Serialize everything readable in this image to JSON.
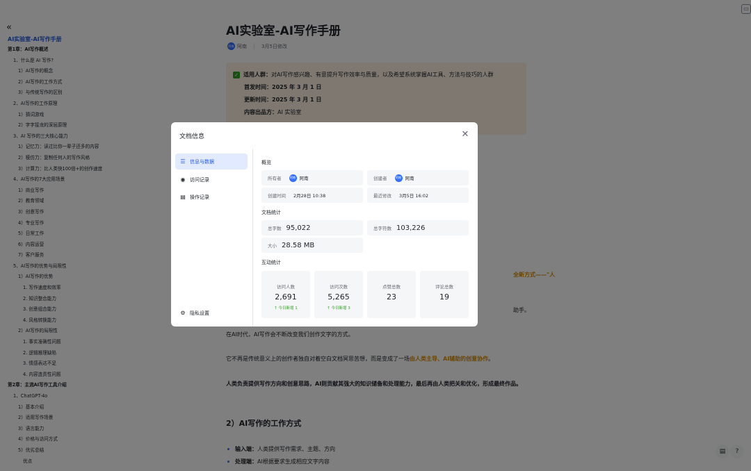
{
  "sidebar": {
    "collapse_icon": "«",
    "title": "AI实验室-AI写作手册",
    "items": [
      {
        "label": "第1章：AI写作概述",
        "level": 0
      },
      {
        "label": "1、什么是 AI 写作?",
        "level": 1
      },
      {
        "label": "1）AI写作的概念",
        "level": 2
      },
      {
        "label": "2）AI写作的工作方式",
        "level": 2
      },
      {
        "label": "3）与传统写作的区别",
        "level": 2
      },
      {
        "label": "2、AI写作的工作原理",
        "level": 1
      },
      {
        "label": "1）猜词游戏",
        "level": 2
      },
      {
        "label": "2）字字接龙的深层原理",
        "level": 2
      },
      {
        "label": "3、AI 写作的三大核心能力",
        "level": 1
      },
      {
        "label": "1）记忆力：读过比你一辈子还多的内容",
        "level": 2
      },
      {
        "label": "2）模仿力：复制任何人的写作风格",
        "level": 2
      },
      {
        "label": "3）计算力：比人类快100倍+的创作速度",
        "level": 2
      },
      {
        "label": "4、AI写作的7大应用场景",
        "level": 1
      },
      {
        "label": "1）商业写作",
        "level": 2
      },
      {
        "label": "2）教育领域",
        "level": 2
      },
      {
        "label": "3）创意写作",
        "level": 2
      },
      {
        "label": "4）专业写作",
        "level": 2
      },
      {
        "label": "5）日常工作",
        "level": 2
      },
      {
        "label": "6）内容运营",
        "level": 2
      },
      {
        "label": "7）客户服务",
        "level": 2
      },
      {
        "label": "5、AI写作的优势与局限性",
        "level": 1
      },
      {
        "label": "1）AI写作的优势",
        "level": 2
      },
      {
        "label": "1. 写作速度和效率",
        "level": 3
      },
      {
        "label": "2. 知识整合能力",
        "level": 3
      },
      {
        "label": "3. 创意组合能力",
        "level": 3
      },
      {
        "label": "4. 风格转换能力",
        "level": 3
      },
      {
        "label": "2）AI写作的局限性",
        "level": 2
      },
      {
        "label": "1. 事实准确性问题",
        "level": 3
      },
      {
        "label": "2. 逻辑推理缺陷",
        "level": 3
      },
      {
        "label": "3. 情感表达不足",
        "level": 3
      },
      {
        "label": "4. 内容连贯性问题",
        "level": 3
      },
      {
        "label": "第2章：主流AI写作工具介绍",
        "level": 0
      },
      {
        "label": "1、ChatGPT-4o",
        "level": 1
      },
      {
        "label": "1）基本介绍",
        "level": 2
      },
      {
        "label": "2）适用写作场景",
        "level": 2
      },
      {
        "label": "3）语言能力",
        "level": 2
      },
      {
        "label": "4）价格与访问方式",
        "level": 2
      },
      {
        "label": "5）优劣总结",
        "level": 2
      },
      {
        "label": "优点",
        "level": 3
      }
    ]
  },
  "doc": {
    "title": "AI实验室-AI写作手册",
    "author_avatar": "阿南",
    "author": "阿南",
    "modified": "3月5日修改",
    "callout": {
      "r1_label": "适用人群：",
      "r1_text": "对AI写作感兴趣、有意提升写作效率与质量，以及希望系统掌握AI工具、方法与技巧的人群",
      "r2_label": "首发时间：",
      "r2_text": "2025 年 3 月 1 日",
      "r3_label": "更新时间：",
      "r3_text": "2025 年 3 月 1 日",
      "r4_label": "内容出品方：",
      "r4_text": "AI 实验室"
    },
    "right_fragment": "全新方式——\"人",
    "right_fragment2": "助手。",
    "p1": "在AI时代，AI写作会不断改变我们创作文字的方式。",
    "p2_a": "它不再是传统意义上的创作者独自对着空白文档冥思苦想，而是变成了一场",
    "p2_b": "由人类主导、AI辅助的创意协作",
    "p2_c": "。",
    "p3": "人类负责提供写作方向和创意思路，AI则贡献其强大的知识储备和处理能力，最后再由人类把关和优化，形成最终作品。",
    "h2": "2）AI写作的工作方式",
    "b1_label": "输入端：",
    "b1_text": "人类提供写作需求、主题、方向",
    "b2_label": "处理端：",
    "b2_text": "AI根据要求生成相应文字内容"
  },
  "modal": {
    "title": "文档信息",
    "close_icon": "✕",
    "nav": [
      {
        "label": "信息与数据",
        "icon": "☰"
      },
      {
        "label": "访问记录",
        "icon": "◉"
      },
      {
        "label": "操作记录",
        "icon": "▤"
      }
    ],
    "settings_icon": "⚙",
    "settings": "隐私设置",
    "overview": {
      "title": "概览",
      "owner_label": "所有者",
      "owner": "阿南",
      "creator_label": "创建者",
      "creator": "阿南",
      "created_label": "创建时间",
      "created": "2月28日 10:38",
      "modified_label": "最近修改",
      "modified": "3月5日 16:02"
    },
    "doc_stats": {
      "title": "文档统计",
      "words_label": "总字数",
      "words": "95,022",
      "chars_label": "总字符数",
      "chars": "103,226",
      "size_label": "大小",
      "size": "28.58 MB"
    },
    "interaction": {
      "title": "互动统计",
      "cards": [
        {
          "label": "访问人数",
          "value": "2,691",
          "delta": "↑ 今日新增 1"
        },
        {
          "label": "访问次数",
          "value": "5,265",
          "delta": "↑ 今日新增 3"
        },
        {
          "label": "点赞总数",
          "value": "23",
          "delta": ""
        },
        {
          "label": "评论总数",
          "value": "19",
          "delta": ""
        }
      ]
    }
  },
  "colors": {
    "accent": "#245bdb",
    "active_bg": "#e1eaff",
    "positive": "#2ea121",
    "callout_bg": "#fdf1e3"
  }
}
